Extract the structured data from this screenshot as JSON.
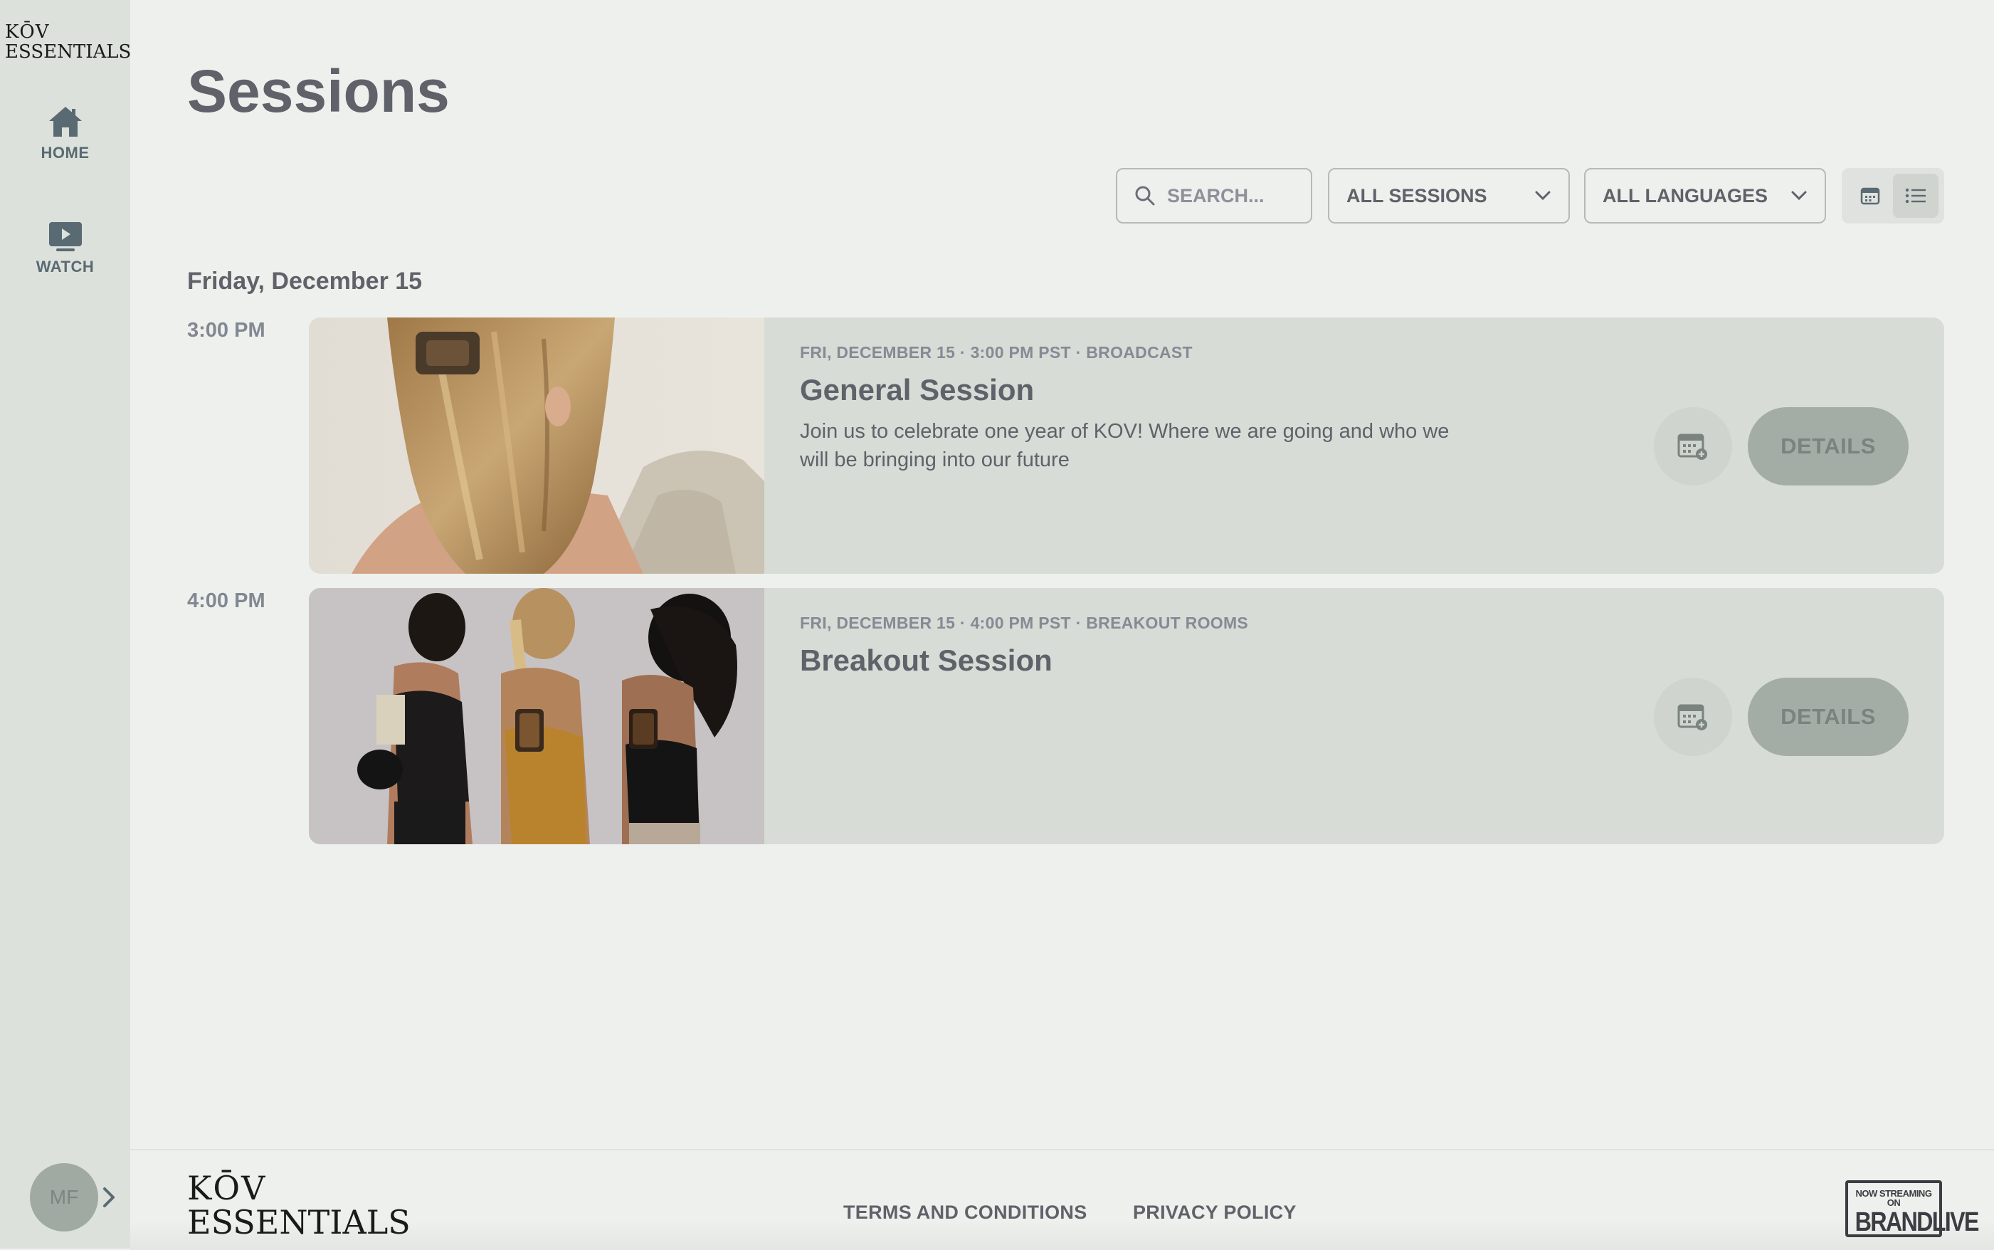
{
  "brand": {
    "logo_line1": "KŌV",
    "logo_line2": "ESSENTIALS"
  },
  "sidebar": {
    "items": [
      {
        "label": "HOME",
        "icon": "home-icon"
      },
      {
        "label": "WATCH",
        "icon": "play-icon"
      }
    ],
    "avatar_initials": "MF"
  },
  "page": {
    "title": "Sessions"
  },
  "filters": {
    "search_placeholder": "SEARCH...",
    "session_filter": "ALL SESSIONS",
    "language_filter": "ALL LANGUAGES",
    "view_modes": [
      "calendar-icon",
      "list-icon"
    ],
    "active_view": "list"
  },
  "schedule": {
    "date": "Friday, December 15",
    "sessions": [
      {
        "time": "3:00 PM",
        "meta": "FRI, DECEMBER 15 · 3:00 PM PST · BROADCAST",
        "title": "General Session",
        "description": "Join us to celebrate one year of KOV! Where we are going and who we will be bringing into our future",
        "details_label": "DETAILS",
        "image": "woman-hair-clip-photo"
      },
      {
        "time": "4:00 PM",
        "meta": "FRI, DECEMBER 15 · 4:00 PM PST · BREAKOUT ROOMS",
        "title": "Breakout Session",
        "description": "",
        "details_label": "DETAILS",
        "image": "three-women-hair-clips-photo"
      }
    ]
  },
  "footer": {
    "logo_line1": "KŌV",
    "logo_line2": "ESSENTIALS",
    "links": [
      "TERMS AND CONDITIONS",
      "PRIVACY POLICY"
    ],
    "badge_line1": "NOW STREAMING ON",
    "badge_line2": "BRANDLIVE"
  },
  "colors": {
    "background": "#eef0ed",
    "sidebar": "#dde1dc",
    "card": "#d7dcd7",
    "details_button": "#a3ada6",
    "text": "#5f6269"
  }
}
